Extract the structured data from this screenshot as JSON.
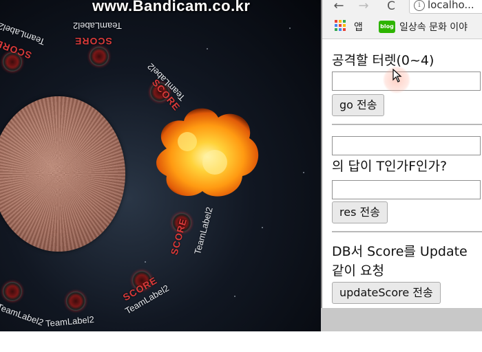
{
  "game": {
    "watermark": "www.Bandicam.co.kr",
    "team_labels": [
      "TeamLabel2",
      "TeamLabel2",
      "TeamLabel2",
      "TeamLabel2",
      "TeamLabel2",
      "TeamLabel2",
      "TeamLabel2"
    ],
    "score_labels": [
      "SCORE",
      "SCORE",
      "SCORE",
      "SCORE",
      "SCORE"
    ]
  },
  "browser": {
    "nav": {
      "back": "←",
      "forward": "→",
      "reload": "C"
    },
    "address": {
      "info_icon": "i",
      "url": "localho..."
    },
    "bookmarks": [
      {
        "icon": "apps-grid-icon",
        "label": "앱"
      },
      {
        "icon": "blog-icon",
        "icon_text": "blog",
        "label": "일상속 문화 이야"
      }
    ],
    "forms": {
      "turret": {
        "label": "공격할 터렛(0~4)",
        "value": "",
        "button": "go 전송"
      },
      "answer": {
        "question_value": "",
        "question_suffix": "의 답이 T인가F인가?",
        "value": "",
        "button": "res 전송"
      },
      "update": {
        "label_line1": "DB서 Score를 Update",
        "label_line2": "같이 요청",
        "button": "updateScore 전송"
      }
    }
  },
  "colors": {
    "score_red": "#d83a3a",
    "button_bg": "#e9e9e9",
    "cursor_highlight": "#ffaa96"
  }
}
